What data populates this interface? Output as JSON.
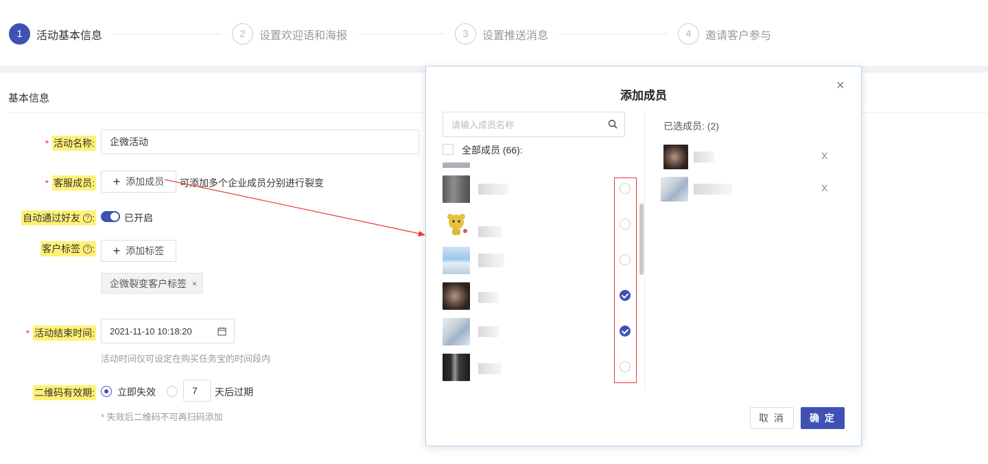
{
  "steps": [
    {
      "num": "1",
      "label": "活动基本信息",
      "active": true
    },
    {
      "num": "2",
      "label": "设置欢迎语和海报",
      "active": false
    },
    {
      "num": "3",
      "label": "设置推送消息",
      "active": false
    },
    {
      "num": "4",
      "label": "邀请客户参与",
      "active": false
    }
  ],
  "form": {
    "section_title": "基本信息",
    "activity_name": {
      "required": "*",
      "label": "活动名称:",
      "value": "企微活动"
    },
    "service_members": {
      "required": "*",
      "label": "客服成员:",
      "button": "添加成员",
      "hint": "可添加多个企业成员分别进行裂变"
    },
    "auto_accept": {
      "label": "自动通过好友",
      "q": "?",
      "colon": ":",
      "status": "已开启"
    },
    "customer_tag": {
      "label": "客户标签",
      "q": "?",
      "colon": ":",
      "button": "添加标签",
      "tag": "企微裂变客户标签",
      "tag_close": "×"
    },
    "end_time": {
      "required": "*",
      "label": "活动结束时间:",
      "value": "2021-11-10 10:18:20",
      "hint": "活动时间仅可设定在购买任务宝的时间段内"
    },
    "qr_validity": {
      "label": "二维码有效期:",
      "option_immediate": "立即失效",
      "days_value": "7",
      "days_suffix": "天后过期",
      "hint": "* 失效后二维码不可再扫码添加"
    }
  },
  "modal": {
    "title": "添加成员",
    "close": "×",
    "search_placeholder": "请输入成员名称",
    "all_members": "全部成员 (66):",
    "selected_title": "已选成员: (2)",
    "remove": "X",
    "members_checked": [
      false,
      false,
      false,
      true,
      true,
      false
    ],
    "cancel": "取 消",
    "ok": "确 定"
  },
  "colors": {
    "primary": "#3f51b5",
    "highlight": "#fff176",
    "annotation": "#e53935"
  }
}
